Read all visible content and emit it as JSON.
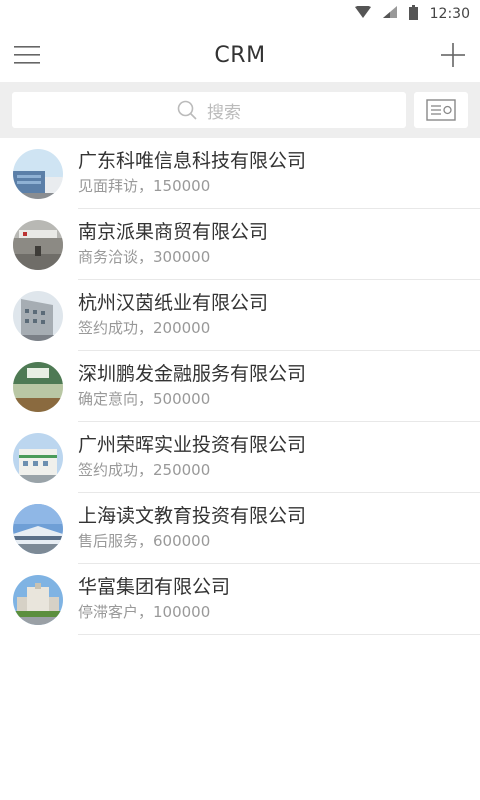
{
  "status_bar": {
    "time": "12:30"
  },
  "app_bar": {
    "title": "CRM"
  },
  "search": {
    "placeholder": "搜索"
  },
  "customers": [
    {
      "name": "广东科唯信息科技有限公司",
      "detail": "见面拜访，150000"
    },
    {
      "name": "南京派果商贸有限公司",
      "detail": "商务洽谈，300000"
    },
    {
      "name": "杭州汉茵纸业有限公司",
      "detail": "签约成功，200000"
    },
    {
      "name": "深圳鹏发金融服务有限公司",
      "detail": "确定意向，500000"
    },
    {
      "name": "广州荣晖实业投资有限公司",
      "detail": "签约成功，250000"
    },
    {
      "name": "上海读文教育投资有限公司",
      "detail": "售后服务，600000"
    },
    {
      "name": "华富集团有限公司",
      "detail": "停滞客户，100000"
    }
  ]
}
